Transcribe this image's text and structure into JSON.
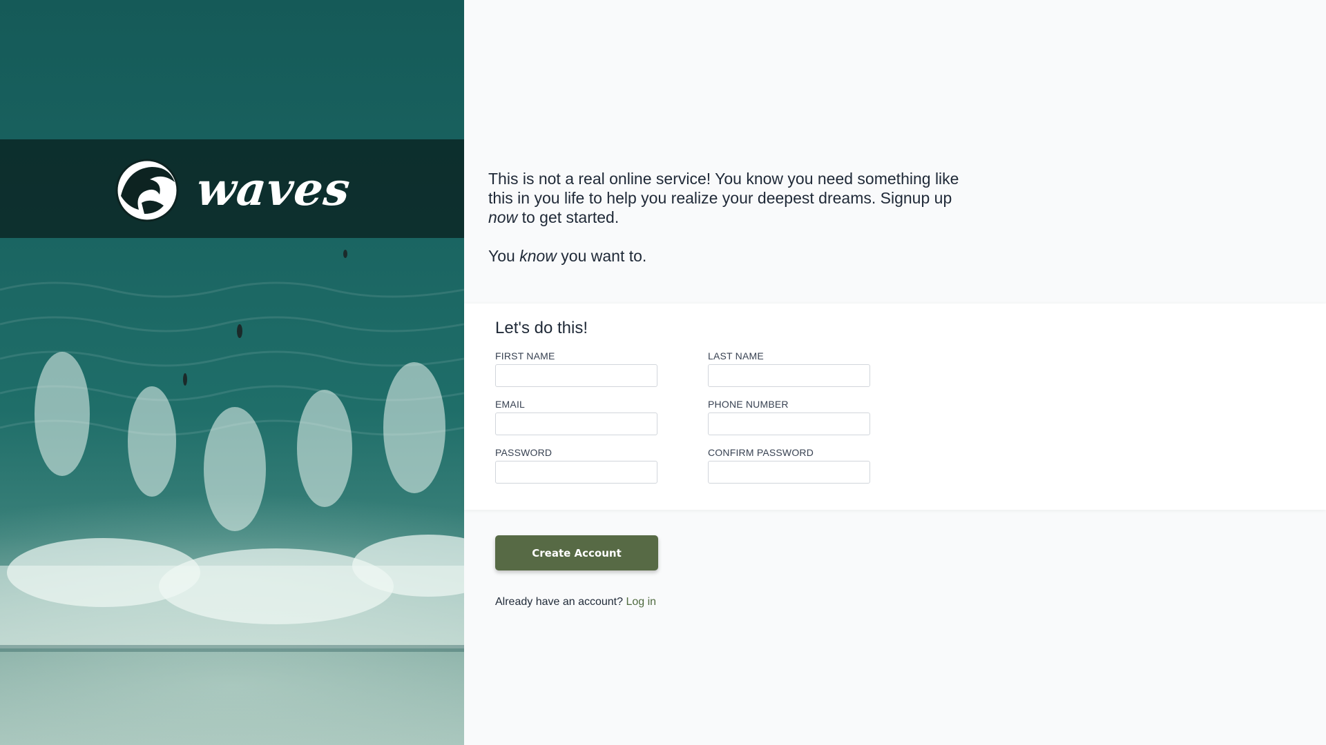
{
  "brand": {
    "name": "waves",
    "logo_icon": "great-wave-icon"
  },
  "intro": {
    "line1_a": "This is not a real online service! You know you need something like this in you life to help you realize your deepest dreams. Signup up ",
    "line1_em": "now",
    "line1_b": " to get started.",
    "line2_a": "You ",
    "line2_em": "know",
    "line2_b": " you want to."
  },
  "form": {
    "title": "Let's do this!",
    "fields": [
      {
        "label": "FIRST NAME",
        "value": ""
      },
      {
        "label": "LAST NAME",
        "value": ""
      },
      {
        "label": "EMAIL",
        "value": ""
      },
      {
        "label": "PHONE NUMBER",
        "value": ""
      },
      {
        "label": "PASSWORD",
        "value": ""
      },
      {
        "label": "CONFIRM PASSWORD",
        "value": ""
      }
    ]
  },
  "actions": {
    "create_label": "Create Account",
    "login_prompt": "Already have an account?",
    "login_link": "Log in"
  },
  "colors": {
    "primary_button": "#576a45",
    "link": "#4f6a3f",
    "page_bg": "#f9fafb"
  }
}
